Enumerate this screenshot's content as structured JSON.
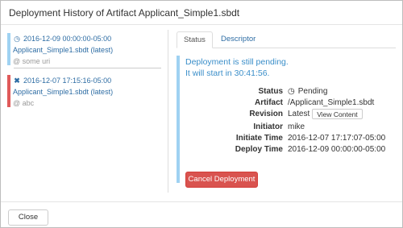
{
  "modal": {
    "title": "Deployment History of Artifact Applicant_Simple1.sbdt"
  },
  "history": [
    {
      "status": "pending",
      "icon": "clock-icon",
      "bar_color": "#9fd2f2",
      "date": "2016-12-09 00:00:00-05:00",
      "artifact": "Applicant_Simple1.sbdt (latest)",
      "location": "@ some uri"
    },
    {
      "status": "failed",
      "icon": "cross-icon",
      "bar_color": "#e05a5a",
      "date": "2016-12-07 17:15:16-05:00",
      "artifact": "Applicant_Simple1.sbdt (latest)",
      "location": "@ abc"
    }
  ],
  "tabs": [
    {
      "label": "Status",
      "active": true
    },
    {
      "label": "Descriptor",
      "active": false
    }
  ],
  "status_panel": {
    "message_line1": "Deployment is still pending.",
    "message_line2": "It will start in 30:41:56.",
    "fields": {
      "status_key": "Status",
      "status_value": "Pending",
      "artifact_key": "Artifact",
      "artifact_value": "/Applicant_Simple1.sbdt",
      "revision_key": "Revision",
      "revision_value": "Latest",
      "view_content_label": "View Content",
      "initiator_key": "Initiator",
      "initiator_value": "mike",
      "initiate_time_key": "Initiate Time",
      "initiate_time_value": "2016-12-07 17:17:07-05:00",
      "deploy_time_key": "Deploy Time",
      "deploy_time_value": "2016-12-09 00:00:00-05:00"
    }
  },
  "buttons": {
    "cancel_deployment": "Cancel Deployment",
    "close": "Close"
  },
  "colors": {
    "accent_blue": "#2e6da4",
    "pending_blue": "#9fd2f2",
    "danger_red": "#d9534f"
  }
}
